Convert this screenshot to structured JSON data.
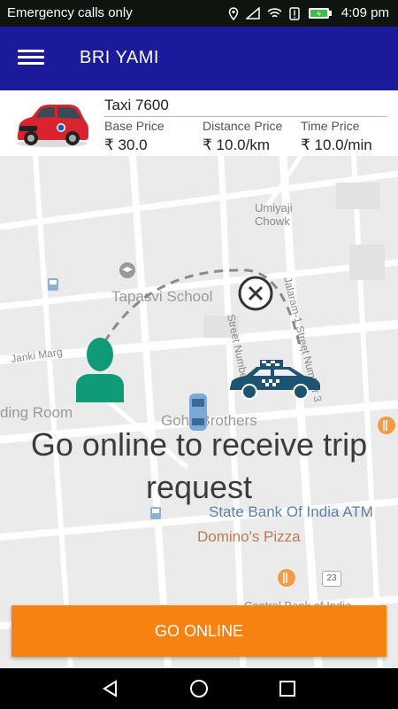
{
  "status_bar": {
    "carrier": "Emergency calls only",
    "time": "4:09 pm"
  },
  "app_bar": {
    "title": "BRI YAMI",
    "color": "#1a1a9b"
  },
  "vehicle": {
    "name": "Taxi 7600",
    "prices": [
      {
        "label": "Base Price",
        "value": "₹ 30.0"
      },
      {
        "label": "Distance Price",
        "value": "₹ 10.0/km"
      },
      {
        "label": "Time Price",
        "value": "₹ 10.0/min"
      }
    ]
  },
  "map": {
    "labels": [
      "Umiyaji Chowk",
      "Tapasvi School",
      "Janki Marg",
      "Street Number",
      "Jalaram-1 Street Number 3",
      "ding Room",
      "Gohil Brothers",
      "State Bank Of India ATM",
      "Domino's Pizza",
      "Central Bank of India"
    ],
    "highway_badge": "23"
  },
  "overlay": {
    "message": "Go online to receive trip request"
  },
  "actions": {
    "go_online_label": "GO ONLINE",
    "accent": "#f7820f"
  },
  "nav_bar": {
    "icons": [
      "back-icon",
      "home-icon",
      "recents-icon"
    ]
  }
}
